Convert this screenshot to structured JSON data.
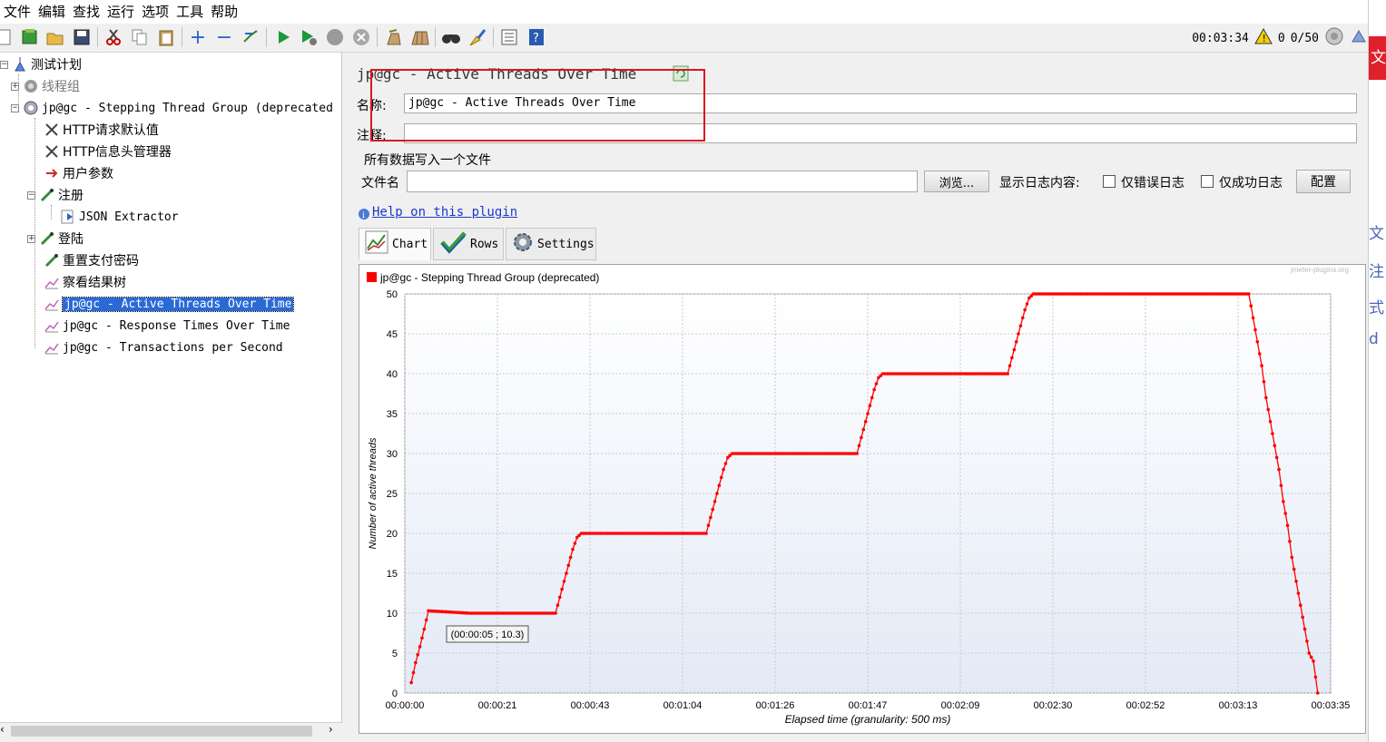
{
  "menu": [
    "文件",
    "编辑",
    "查找",
    "运行",
    "选项",
    "工具",
    "帮助"
  ],
  "toolbar": {
    "icons": [
      "new-icon",
      "templates-icon",
      "open-icon",
      "save-icon",
      "cut-icon",
      "copy-icon",
      "paste-icon",
      "expand-icon",
      "collapse-icon",
      "toggle-icon",
      "start-icon",
      "start-no-pause-icon",
      "stop-icon",
      "shutdown-icon",
      "clear-icon",
      "clear-all-icon",
      "search-icon",
      "reset-search-icon",
      "function-helper-icon",
      "help-icon"
    ],
    "elapsed": "00:03:34",
    "warnings": "0",
    "threads": "0/50"
  },
  "tree": {
    "items": [
      {
        "label": "测试计划",
        "icon": "test-plan-icon"
      },
      {
        "label": "线程组",
        "icon": "thread-group-icon"
      },
      {
        "label": "jp@gc - Stepping Thread Group (deprecated",
        "icon": "gear-icon"
      },
      {
        "label": "HTTP请求默认值",
        "icon": "wrench-icon"
      },
      {
        "label": "HTTP信息头管理器",
        "icon": "wrench-icon"
      },
      {
        "label": "用户参数",
        "icon": "preprocessor-icon"
      },
      {
        "label": "注册",
        "icon": "sampler-icon"
      },
      {
        "label": "JSON Extractor",
        "icon": "extractor-icon"
      },
      {
        "label": "登陆",
        "icon": "sampler-icon"
      },
      {
        "label": "重置支付密码",
        "icon": "sampler-icon"
      },
      {
        "label": "察看结果树",
        "icon": "listener-icon"
      },
      {
        "label": "jp@gc - Active Threads Over Time",
        "icon": "listener-icon"
      },
      {
        "label": "jp@gc - Response Times Over Time",
        "icon": "listener-icon"
      },
      {
        "label": "jp@gc - Transactions per Second",
        "icon": "listener-icon"
      }
    ]
  },
  "panel": {
    "title": "jp@gc - Active Threads Over Time",
    "name_label": "名称:",
    "name_value": "jp@gc - Active Threads Over Time",
    "comment_label": "注释:",
    "comment_value": "",
    "file_section": "所有数据写入一个文件",
    "filename_label": "文件名",
    "filename_value": "",
    "browse": "浏览...",
    "log_label": "显示日志内容:",
    "errors_only": "仅错误日志",
    "success_only": "仅成功日志",
    "config": "配置",
    "help_link": "Help on this plugin",
    "tabs": [
      "Chart",
      "Rows",
      "Settings"
    ]
  },
  "chart_data": {
    "type": "line",
    "legend": "jp@gc - Stepping Thread Group (deprecated)",
    "watermark": "jmeter-plugins.org",
    "xlabel": "Elapsed time (granularity: 500 ms)",
    "ylabel": "Number of active threads",
    "x_ticks": [
      "00:00:00",
      "00:00:21",
      "00:00:43",
      "00:01:04",
      "00:01:26",
      "00:01:47",
      "00:02:09",
      "00:02:30",
      "00:02:52",
      "00:03:13",
      "00:03:35"
    ],
    "y_ticks": [
      "0",
      "5",
      "10",
      "15",
      "20",
      "25",
      "30",
      "35",
      "40",
      "45",
      "50"
    ],
    "xlim": [
      0,
      215
    ],
    "ylim": [
      0,
      50
    ],
    "grid": true,
    "color": "#ff0000",
    "tooltip": "(00:00:05 ; 10.3)",
    "series": [
      {
        "name": "jp@gc - Stepping Thread Group (deprecated)",
        "x": [
          1.5,
          2.5,
          3.5,
          4.5,
          5.5,
          15,
          25,
          35,
          36,
          37,
          38,
          39,
          40,
          41,
          50,
          60,
          70,
          71,
          72,
          73,
          74,
          75,
          76,
          85,
          95,
          105,
          106,
          107,
          108,
          109,
          110,
          111,
          120,
          130,
          140,
          141,
          142,
          143,
          144,
          145,
          146,
          155,
          170,
          185,
          196,
          197,
          198,
          199,
          200,
          201,
          202,
          203,
          204,
          205,
          206,
          207,
          208,
          209,
          210,
          211,
          212
        ],
        "y": [
          1.3,
          3.8,
          5.8,
          8,
          10.3,
          10,
          10,
          10,
          12,
          14,
          16,
          18,
          19.5,
          20,
          20,
          20,
          20,
          22,
          24,
          26,
          28,
          29.5,
          30,
          30,
          30,
          30,
          32,
          34,
          36,
          38,
          39.5,
          40,
          40,
          40,
          40,
          42,
          44,
          46,
          48,
          49.5,
          50,
          50,
          50,
          50,
          50,
          47,
          44,
          41,
          37,
          34,
          31,
          28,
          24,
          21,
          17,
          14,
          11,
          8,
          5,
          4,
          0
        ]
      }
    ]
  },
  "edge": {
    "chars": [
      "文",
      "文",
      "注",
      "式",
      "d"
    ]
  }
}
